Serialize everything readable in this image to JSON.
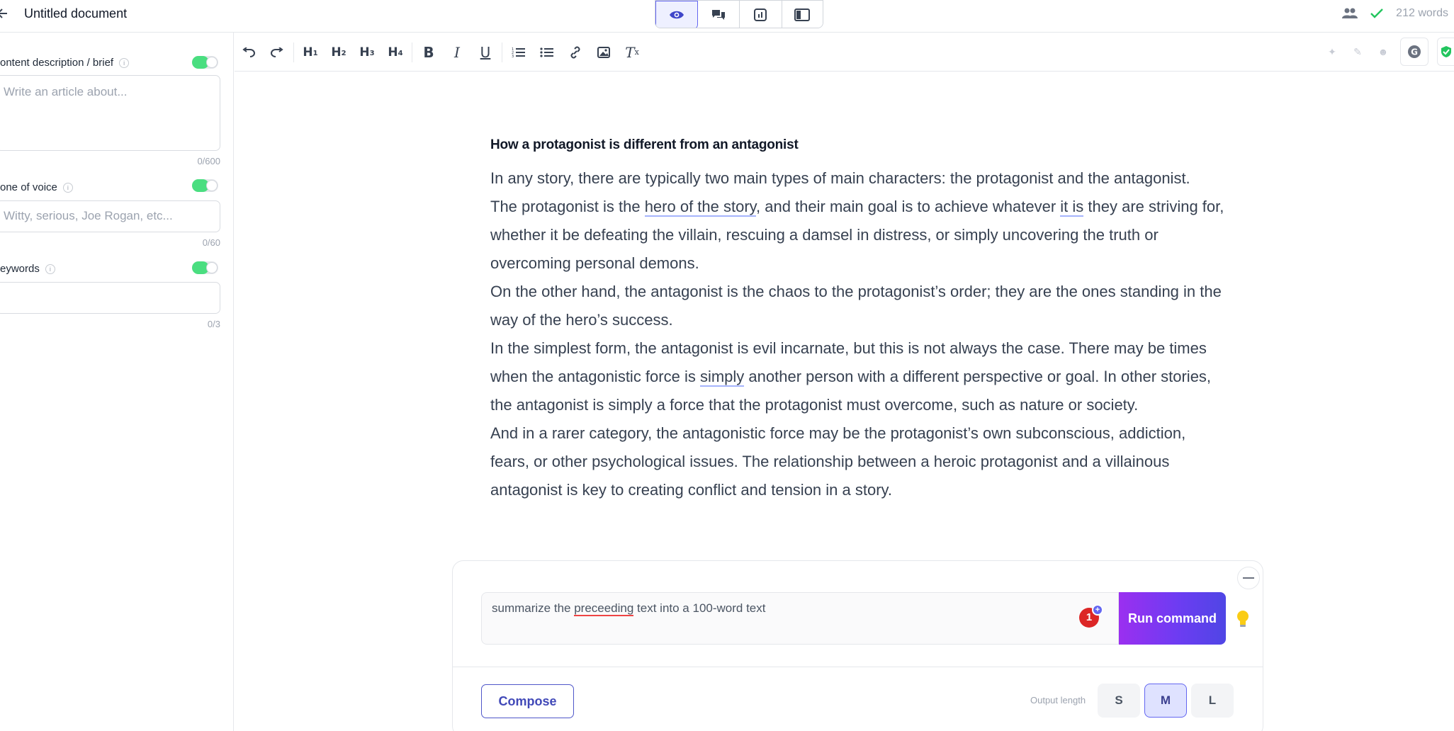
{
  "topbar": {
    "back_icon": "arrow-left-icon",
    "title": "Untitled document",
    "view_modes": [
      {
        "icon": "eye-icon",
        "active": true
      },
      {
        "icon": "chat-icon",
        "active": false
      },
      {
        "icon": "chart-icon",
        "active": false
      },
      {
        "icon": "sidebar-icon",
        "active": false
      }
    ],
    "collaborators_icon": "users-icon",
    "saved_icon": "check-icon",
    "word_count": "212 words"
  },
  "left_panel": {
    "description": {
      "label": "ontent description / brief",
      "enabled": true,
      "placeholder": "Write an article about...",
      "count": "0/600"
    },
    "tone": {
      "label": "one of voice",
      "enabled": true,
      "placeholder": "Witty, serious, Joe Rogan, etc...",
      "count": "0/60"
    },
    "keywords": {
      "label": "eywords",
      "enabled": true,
      "placeholder": "",
      "count": "0/3"
    }
  },
  "toolbar": {
    "items": [
      "undo-icon",
      "redo-icon",
      "H1",
      "H2",
      "H3",
      "H4",
      "bold-icon",
      "italic-icon",
      "underline-icon",
      "ordered-list-icon",
      "bullet-list-icon",
      "link-icon",
      "image-icon",
      "clear-format-icon"
    ],
    "right_icons": [
      "sparkle-icon",
      "pen-icon",
      "emoji-icon",
      "grammarly-icon",
      "shield-icon"
    ]
  },
  "document": {
    "heading": "How a protagonist is different from an antagonist",
    "p1": "In any story, there are typically two main types of main characters: the protagonist and the antagonist.",
    "p2_a": "The protagonist is the ",
    "p2_u1": "hero of the story",
    "p2_b": ", and their main goal is to achieve whatever ",
    "p2_u2": "it is",
    "p2_c": " they are striving for, whether it be defeating the villain, rescuing a damsel in distress, or simply uncovering the truth or overcoming personal demons.",
    "p3": "On the other hand, the antagonist is the chaos to the protagonist’s order; they are the ones standing in the way of the hero’s success.",
    "p4_a": "In the simplest form, the antagonist is evil incarnate, but this is not always the case. There may be times when the antagonistic force is ",
    "p4_u": "simply",
    "p4_b": " another person with a different perspective or goal. In other stories, the antagonist is simply a force that the protagonist must overcome, such as nature or society.",
    "p5": "And in a rarer category, the antagonistic force may be the protagonist’s own subconscious, addiction, fears, or other psychological issues. The relationship between a heroic protagonist and a villainous antagonist is key to creating conflict and tension in a story."
  },
  "command": {
    "text_a": "summarize the ",
    "text_misspelled": "preceeding",
    "text_b": " text into a 100-word text",
    "badge": "1",
    "badge_plus": "+",
    "run_label": "Run command",
    "bulb_icon": "lightbulb-icon",
    "compose_label": "Compose",
    "output_label": "Output length",
    "sizes": [
      "S",
      "M",
      "L"
    ],
    "selected_size": "M"
  },
  "colors": {
    "accent": "#6366f1",
    "toggle_on": "#4ade80",
    "run_gradient_start": "#9b2ff0",
    "run_gradient_end": "#4f46e5",
    "error_underline": "#ef4444"
  }
}
